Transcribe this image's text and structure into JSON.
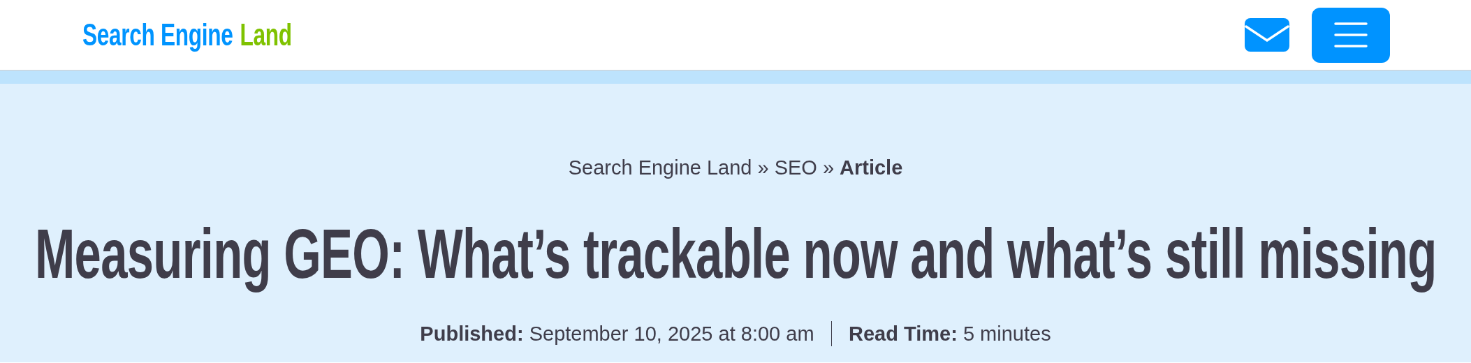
{
  "header": {
    "logo": [
      {
        "text": "Search Engine",
        "color": "#0094ff"
      },
      {
        "text": "Land",
        "color": "#7fc200"
      }
    ]
  },
  "breadcrumb": [
    {
      "kind": "link",
      "text": "Search Engine Land"
    },
    {
      "kind": "separator",
      "text": "»"
    },
    {
      "kind": "link",
      "text": "SEO"
    },
    {
      "kind": "separator",
      "text": "»"
    },
    {
      "kind": "current",
      "text": "Article"
    }
  ],
  "title": "Measuring GEO: What’s trackable now and what’s still missing",
  "meta": [
    {
      "label": "Published:",
      "value": "September 10, 2025 at 8:00 am"
    },
    {
      "label": "Read Time:",
      "value": "5 minutes"
    }
  ]
}
